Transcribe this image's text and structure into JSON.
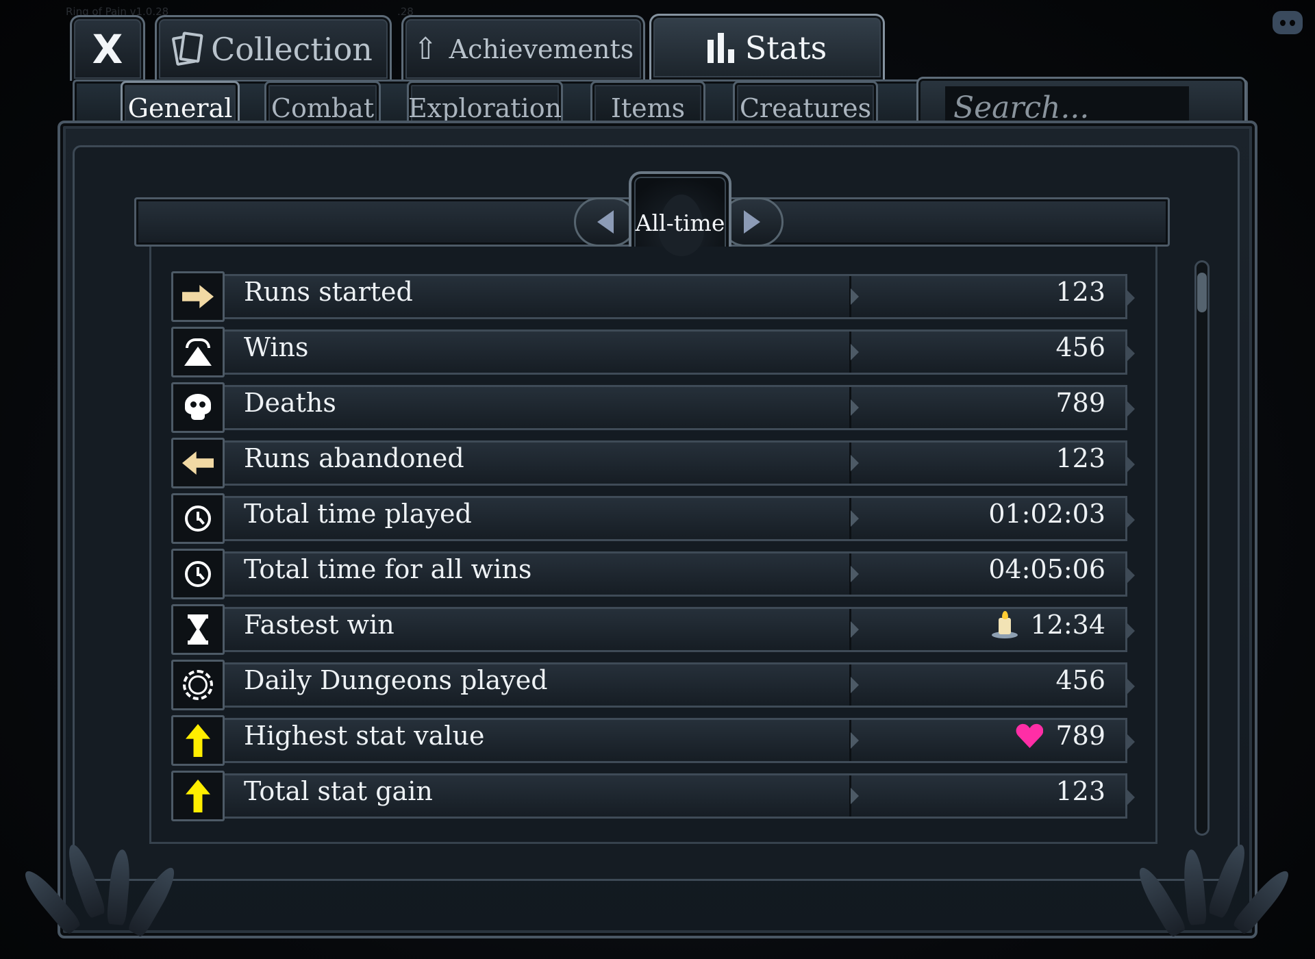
{
  "app": {
    "version": "Ring of Pain v1.0.28",
    "version_suffix": ".28"
  },
  "top_tabs": {
    "close_label": "X",
    "collection_label": "Collection",
    "achievements_label": "Achievements",
    "stats_label": "Stats",
    "active": "Stats"
  },
  "sub_tabs": {
    "general": "General",
    "combat": "Combat",
    "exploration": "Exploration",
    "items": "Items",
    "creatures": "Creatures",
    "active": "General"
  },
  "search": {
    "placeholder": "Search...",
    "value": ""
  },
  "period": {
    "label": "All-time"
  },
  "stats": [
    {
      "label": "Runs started",
      "value": "123",
      "icon": "arrow-right-icon"
    },
    {
      "label": "Wins",
      "value": "456",
      "icon": "mountain-win-icon"
    },
    {
      "label": "Deaths",
      "value": "789",
      "icon": "skull-icon"
    },
    {
      "label": "Runs abandoned",
      "value": "123",
      "icon": "arrow-left-icon"
    },
    {
      "label": "Total time played",
      "value": "01:02:03",
      "icon": "clock-icon"
    },
    {
      "label": "Total time for all wins",
      "value": "04:05:06",
      "icon": "clock-icon"
    },
    {
      "label": "Fastest win",
      "value": "12:34",
      "icon": "hourglass-icon",
      "value_icon": "candle-icon"
    },
    {
      "label": "Daily Dungeons played",
      "value": "456",
      "icon": "thorn-ring-icon"
    },
    {
      "label": "Highest stat value",
      "value": "789",
      "icon": "up-arrow-icon",
      "value_icon": "heart-icon"
    },
    {
      "label": "Total stat gain",
      "value": "123",
      "icon": "up-arrow-icon"
    }
  ],
  "colors": {
    "accent_arrow": "#f1d9a4",
    "stat_up": "#ffee00",
    "heart": "#ff2ea6",
    "panel_border": "#4a5764"
  }
}
